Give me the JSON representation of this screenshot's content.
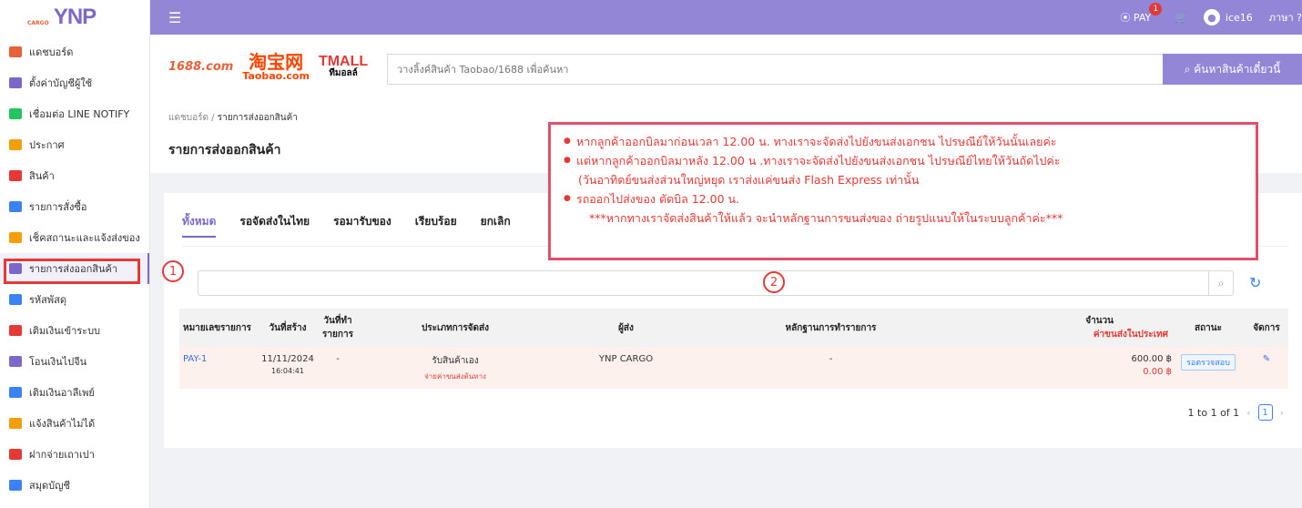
{
  "logo": {
    "main": "YNP",
    "sub": "CARGO"
  },
  "sidebar": {
    "items": [
      {
        "label": "แดชบอร์ด",
        "color": "#e7623a"
      },
      {
        "label": "ตั้งค่าบัญชีผู้ใช้",
        "color": "#7b68c9"
      },
      {
        "label": "เชื่อมต่อ LINE NOTIFY",
        "color": "#22c55e"
      },
      {
        "label": "ประกาศ",
        "color": "#f59e0b"
      },
      {
        "label": "สินค้า",
        "color": "#e53935"
      },
      {
        "label": "รายการสั่งซื้อ",
        "color": "#3b82f6"
      },
      {
        "label": "เช็คสถานะและแจ้งส่งของ",
        "color": "#f59e0b"
      },
      {
        "label": "รายการส่งออกสินค้า",
        "color": "#7b68c9"
      },
      {
        "label": "รหัสพัสดุ",
        "color": "#3b82f6"
      },
      {
        "label": "เติมเงินเข้าระบบ",
        "color": "#e53935"
      },
      {
        "label": "โอนเงินไปจีน",
        "color": "#7b68c9"
      },
      {
        "label": "เติมเงินอาลีเพย์",
        "color": "#3b82f6"
      },
      {
        "label": "แจ้งสินค้าไม่ได้",
        "color": "#f59e0b"
      },
      {
        "label": "ฝากจ่ายเถาเปา",
        "color": "#e53935"
      },
      {
        "label": "สมุดบัญชี",
        "color": "#3b82f6"
      }
    ]
  },
  "topbar": {
    "pay_label": "PAY",
    "pay_badge": "1",
    "username": "ice16",
    "lang": "ภาษา ?"
  },
  "brands": {
    "b1688": "1688.com",
    "taobao_zh": "淘宝网",
    "taobao_en": "Taobao.com",
    "tmall": "TMALL",
    "tmall_sub": "ทีมอลล์"
  },
  "search": {
    "placeholder": "วางลิ้งค์สินค้า Taobao/1688 เพื่อค้นหา",
    "button": "ค้นหาสินค้าเดี๋ยวนี้"
  },
  "breadcrumb": {
    "root": "แดชบอร์ด",
    "sep": "/",
    "current": "รายการส่งออกสินค้า"
  },
  "page_title": "รายการส่งออกสินค้า",
  "tabs": [
    "ทั้งหมด",
    "รอจัดส่งในไทย",
    "รอมารับของ",
    "เรียบร้อย",
    "ยกเลิก"
  ],
  "table": {
    "headers": {
      "id": "หมายเลขรายการ",
      "created": "วันที่สร้าง",
      "done": "วันที่ทำรายการ",
      "type": "ประเภทการจัดส่ง",
      "sender": "ผู้ส่ง",
      "evidence": "หลักฐานการทำรายการ",
      "amount": "จำนวน",
      "amount_sub": "ค่าขนส่งในประเทศ",
      "status": "สถานะ",
      "manage": "จัดการ"
    },
    "rows": [
      {
        "id": "PAY-1",
        "date": "11/11/2024",
        "time": "16:04:41",
        "done": "-",
        "type": "รับสินค้าเอง",
        "type_sub": "จ่ายค่าขนส่งต้นทาง",
        "sender": "YNP CARGO",
        "evidence": "-",
        "amount": "600.00 ฿",
        "amount_sub": "0.00 ฿",
        "status": "รอตรวจสอบ"
      }
    ]
  },
  "pager": {
    "text": "1 to 1 of 1",
    "page": "1"
  },
  "annotations": {
    "one": "1",
    "two": "2"
  },
  "notice": {
    "lines": [
      "หากลูกค้าออกบิลมาก่อนเวลา 12.00 น. ทางเราจะจัดส่งไปยังขนส่งเอกชน  ไปรษณีย์ให้วันนั้นเลยค่ะ",
      "แต่หากลูกค้าออกบิลมาหลัง 12.00 น .ทางเราจะจัดส่งไปยังขนส่งเอกชน ไปรษณีย์ไทยให้วันถัดไปค่ะ",
      "(วันอาทิตย์ขนส่งส่วนใหญ่หยุด เราส่งแค่ขนส่ง Flash Express เท่านั้น",
      "รถออกไปส่งของ ตัดบิล 12.00 น.",
      "***หากทางเราจัดส่งสินค้าให้แล้ว จะนำหลักฐานการขนส่งของ ถ่ายรูปแนบให้ในระบบลูกค้าค่ะ***"
    ]
  }
}
